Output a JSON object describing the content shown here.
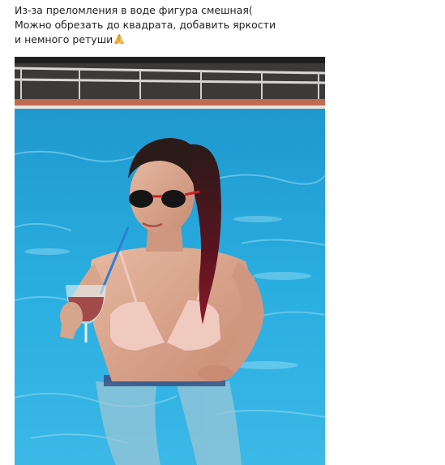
{
  "caption": {
    "line1": "Из-за преломления в воде фигура смешная(",
    "line2": "Можно обрезать до квадрата, добавить яркости",
    "line3": "и немного ретуши",
    "emoji_icon": "folded-hands-emoji"
  },
  "photo": {
    "subject": "woman-in-pool-photo",
    "water_color": "#27a6da",
    "deck_color": "#3a3a3a"
  }
}
